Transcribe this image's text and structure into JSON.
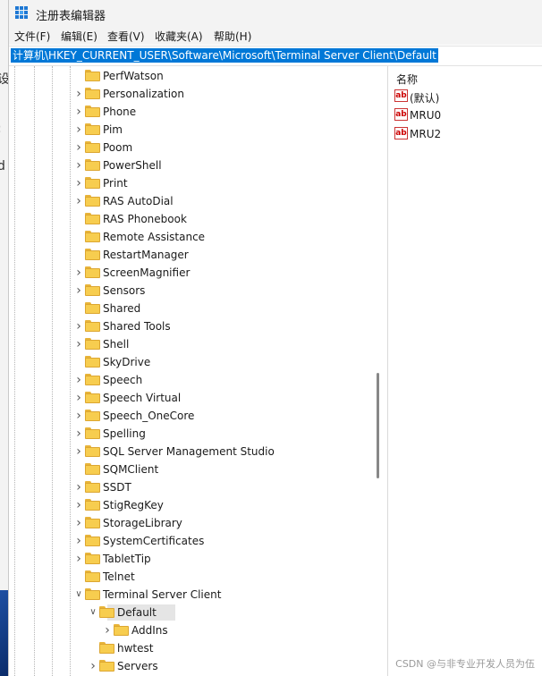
{
  "background_window": {
    "fragments": [
      "设",
      ":",
      "d"
    ]
  },
  "window": {
    "title": "注册表编辑器",
    "menu": [
      "文件(F)",
      "编辑(E)",
      "查看(V)",
      "收藏夹(A)",
      "帮助(H)"
    ],
    "address": "计算机\\HKEY_CURRENT_USER\\Software\\Microsoft\\Terminal Server Client\\Default"
  },
  "tree": {
    "items": [
      {
        "label": "PerfWatson",
        "expander": "none"
      },
      {
        "label": "Personalization",
        "expander": "collapsed"
      },
      {
        "label": "Phone",
        "expander": "collapsed"
      },
      {
        "label": "Pim",
        "expander": "collapsed"
      },
      {
        "label": "Poom",
        "expander": "collapsed"
      },
      {
        "label": "PowerShell",
        "expander": "collapsed"
      },
      {
        "label": "Print",
        "expander": "collapsed"
      },
      {
        "label": "RAS AutoDial",
        "expander": "collapsed"
      },
      {
        "label": "RAS Phonebook",
        "expander": "none"
      },
      {
        "label": "Remote Assistance",
        "expander": "none"
      },
      {
        "label": "RestartManager",
        "expander": "none"
      },
      {
        "label": "ScreenMagnifier",
        "expander": "collapsed"
      },
      {
        "label": "Sensors",
        "expander": "collapsed"
      },
      {
        "label": "Shared",
        "expander": "none"
      },
      {
        "label": "Shared Tools",
        "expander": "collapsed"
      },
      {
        "label": "Shell",
        "expander": "collapsed"
      },
      {
        "label": "SkyDrive",
        "expander": "none"
      },
      {
        "label": "Speech",
        "expander": "collapsed"
      },
      {
        "label": "Speech Virtual",
        "expander": "collapsed"
      },
      {
        "label": "Speech_OneCore",
        "expander": "collapsed"
      },
      {
        "label": "Spelling",
        "expander": "collapsed"
      },
      {
        "label": "SQL Server Management Studio",
        "expander": "collapsed"
      },
      {
        "label": "SQMClient",
        "expander": "none"
      },
      {
        "label": "SSDT",
        "expander": "collapsed"
      },
      {
        "label": "StigRegKey",
        "expander": "collapsed"
      },
      {
        "label": "StorageLibrary",
        "expander": "collapsed"
      },
      {
        "label": "SystemCertificates",
        "expander": "collapsed"
      },
      {
        "label": "TabletTip",
        "expander": "collapsed"
      },
      {
        "label": "Telnet",
        "expander": "none"
      },
      {
        "label": "Terminal Server Client",
        "expander": "expanded"
      },
      {
        "label": "Default",
        "expander": "expanded",
        "selected": true,
        "depth": 1
      },
      {
        "label": "AddIns",
        "expander": "collapsed",
        "depth": 2
      },
      {
        "label": "hwtest",
        "expander": "none",
        "depth": 1
      },
      {
        "label": "Servers",
        "expander": "collapsed",
        "depth": 1
      }
    ]
  },
  "values": {
    "header": "名称",
    "icon": "string-value-icon",
    "icon_glyph": "ab",
    "items": [
      {
        "name": "(默认)"
      },
      {
        "name": "MRU0"
      },
      {
        "name": "MRU2"
      }
    ]
  },
  "watermark": "CSDN @与非专业开发人员为伍",
  "colors": {
    "selection": "#0078d7",
    "folder": "#f7cd4f",
    "icon_red": "#cc0000"
  }
}
